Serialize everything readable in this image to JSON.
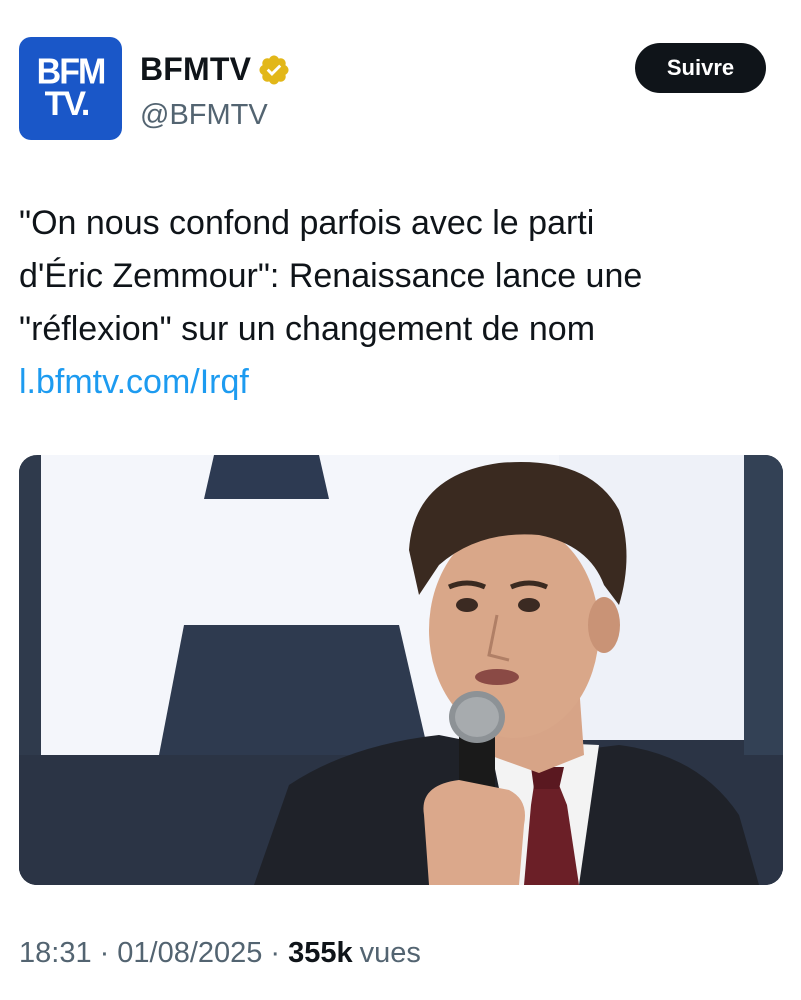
{
  "account": {
    "avatar_line1": "BFM",
    "avatar_line2": "TV.",
    "display_name": "BFMTV",
    "handle": "@BFMTV",
    "verified_color": "#e2b719"
  },
  "follow_label": "Suivre",
  "tweet": {
    "text": "\"On nous confond parfois avec le parti\nd'Éric Zemmour\": Renaissance lance une\n\"réflexion\" sur un changement de nom",
    "link": "l.bfmtv.com/Irqf"
  },
  "meta": {
    "time": "18:31",
    "date": "01/08/2025",
    "views_count": "355k",
    "views_label": "vues"
  },
  "colors": {
    "link": "#1d9bf0",
    "avatar_bg": "#1a57c8",
    "button_bg": "#0f1419"
  }
}
